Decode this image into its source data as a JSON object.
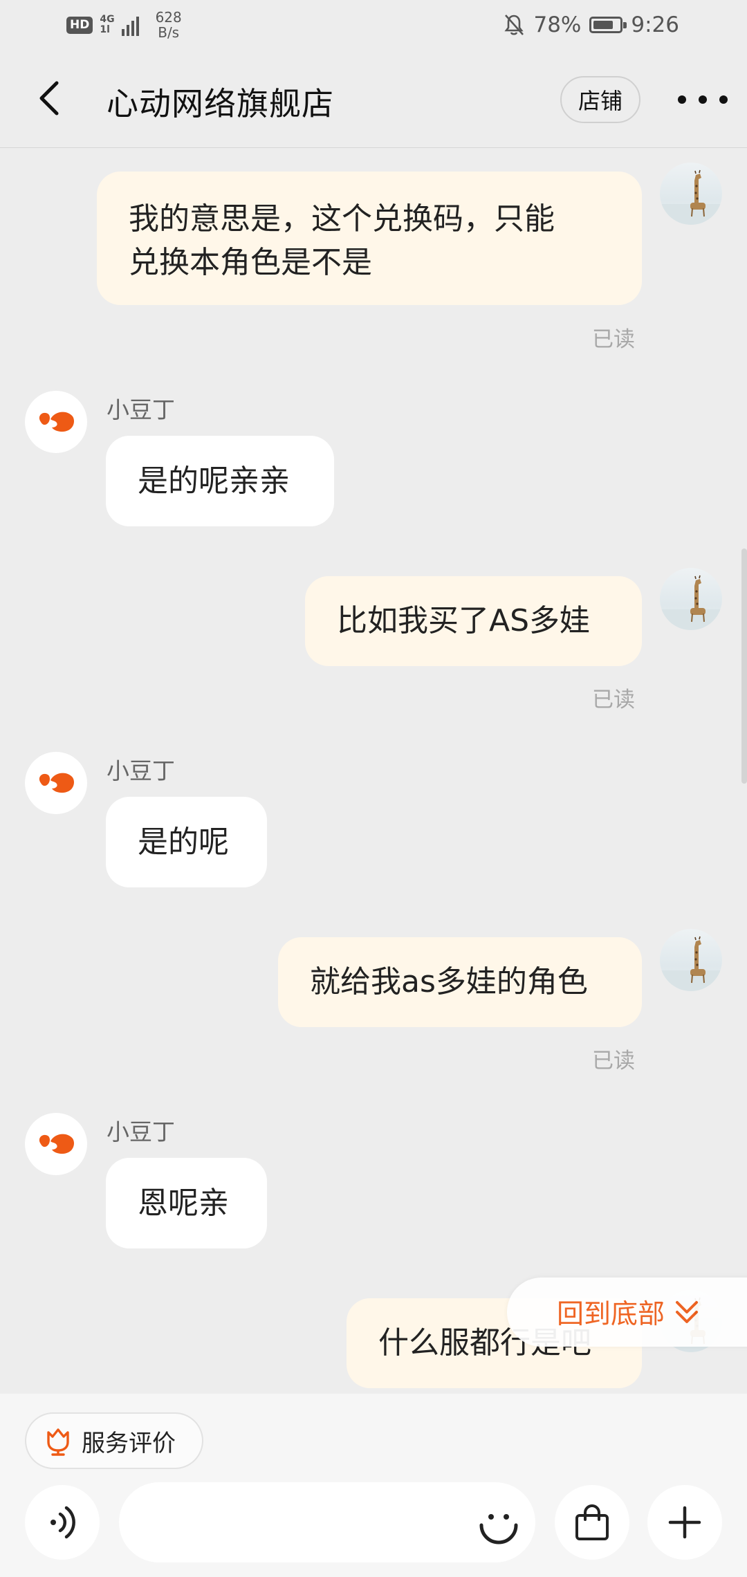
{
  "status_bar": {
    "hd": "HD",
    "net_type_top": "4G",
    "net_type_bottom": "1l",
    "speed_value": "628",
    "speed_unit": "B/s",
    "battery": "78%",
    "time": "9:26",
    "battery_level": 0.78
  },
  "header": {
    "title": "心动网络旗舰店",
    "store_button": "店铺"
  },
  "messages": [
    {
      "side": "me",
      "lines": [
        "我的意思是，这个兑换码，只能",
        "兑换本角色是不是"
      ],
      "status": "已读"
    },
    {
      "side": "them",
      "sender": "小豆丁",
      "text": "是的呢亲亲"
    },
    {
      "side": "me",
      "text": "比如我买了AS多娃",
      "status": "已读"
    },
    {
      "side": "them",
      "sender": "小豆丁",
      "text": "是的呢"
    },
    {
      "side": "me",
      "text": "就给我as多娃的角色",
      "status": "已读"
    },
    {
      "side": "them",
      "sender": "小豆丁",
      "text": "恩呢亲"
    },
    {
      "side": "me",
      "text": "什么服都行是吧"
    }
  ],
  "back_to_bottom": "回到底部",
  "bottom": {
    "service_rating": "服务评价",
    "input_placeholder": ""
  },
  "colors": {
    "background": "#ededed",
    "my_bubble": "#fff7e9",
    "their_bubble": "#ffffff",
    "accent": "#ee5a15"
  },
  "icons": [
    "back-arrow-icon",
    "more-dots-icon",
    "shop-logo-icon",
    "giraffe-avatar-icon",
    "double-chevron-down-icon",
    "tulip-rating-icon",
    "voice-icon",
    "emoji-icon",
    "shopping-bag-icon",
    "plus-icon"
  ]
}
